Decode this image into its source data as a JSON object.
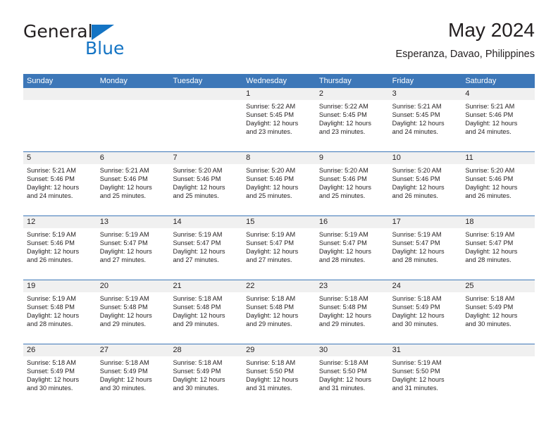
{
  "brand": {
    "name_top": "General",
    "name_bottom": "Blue",
    "triangle_color": "#1474c4"
  },
  "header": {
    "title": "May 2024",
    "subtitle": "Esperanza, Davao, Philippines",
    "accent_color": "#3d77b8",
    "band_color": "#f0f0f0"
  },
  "calendar": {
    "weekday_headers": [
      "Sunday",
      "Monday",
      "Tuesday",
      "Wednesday",
      "Thursday",
      "Friday",
      "Saturday"
    ],
    "weeks": [
      [
        {
          "day": "",
          "lines": []
        },
        {
          "day": "",
          "lines": []
        },
        {
          "day": "",
          "lines": []
        },
        {
          "day": "1",
          "lines": [
            "Sunrise: 5:22 AM",
            "Sunset: 5:45 PM",
            "Daylight: 12 hours",
            "and 23 minutes."
          ]
        },
        {
          "day": "2",
          "lines": [
            "Sunrise: 5:22 AM",
            "Sunset: 5:45 PM",
            "Daylight: 12 hours",
            "and 23 minutes."
          ]
        },
        {
          "day": "3",
          "lines": [
            "Sunrise: 5:21 AM",
            "Sunset: 5:45 PM",
            "Daylight: 12 hours",
            "and 24 minutes."
          ]
        },
        {
          "day": "4",
          "lines": [
            "Sunrise: 5:21 AM",
            "Sunset: 5:46 PM",
            "Daylight: 12 hours",
            "and 24 minutes."
          ]
        }
      ],
      [
        {
          "day": "5",
          "lines": [
            "Sunrise: 5:21 AM",
            "Sunset: 5:46 PM",
            "Daylight: 12 hours",
            "and 24 minutes."
          ]
        },
        {
          "day": "6",
          "lines": [
            "Sunrise: 5:21 AM",
            "Sunset: 5:46 PM",
            "Daylight: 12 hours",
            "and 25 minutes."
          ]
        },
        {
          "day": "7",
          "lines": [
            "Sunrise: 5:20 AM",
            "Sunset: 5:46 PM",
            "Daylight: 12 hours",
            "and 25 minutes."
          ]
        },
        {
          "day": "8",
          "lines": [
            "Sunrise: 5:20 AM",
            "Sunset: 5:46 PM",
            "Daylight: 12 hours",
            "and 25 minutes."
          ]
        },
        {
          "day": "9",
          "lines": [
            "Sunrise: 5:20 AM",
            "Sunset: 5:46 PM",
            "Daylight: 12 hours",
            "and 25 minutes."
          ]
        },
        {
          "day": "10",
          "lines": [
            "Sunrise: 5:20 AM",
            "Sunset: 5:46 PM",
            "Daylight: 12 hours",
            "and 26 minutes."
          ]
        },
        {
          "day": "11",
          "lines": [
            "Sunrise: 5:20 AM",
            "Sunset: 5:46 PM",
            "Daylight: 12 hours",
            "and 26 minutes."
          ]
        }
      ],
      [
        {
          "day": "12",
          "lines": [
            "Sunrise: 5:19 AM",
            "Sunset: 5:46 PM",
            "Daylight: 12 hours",
            "and 26 minutes."
          ]
        },
        {
          "day": "13",
          "lines": [
            "Sunrise: 5:19 AM",
            "Sunset: 5:47 PM",
            "Daylight: 12 hours",
            "and 27 minutes."
          ]
        },
        {
          "day": "14",
          "lines": [
            "Sunrise: 5:19 AM",
            "Sunset: 5:47 PM",
            "Daylight: 12 hours",
            "and 27 minutes."
          ]
        },
        {
          "day": "15",
          "lines": [
            "Sunrise: 5:19 AM",
            "Sunset: 5:47 PM",
            "Daylight: 12 hours",
            "and 27 minutes."
          ]
        },
        {
          "day": "16",
          "lines": [
            "Sunrise: 5:19 AM",
            "Sunset: 5:47 PM",
            "Daylight: 12 hours",
            "and 28 minutes."
          ]
        },
        {
          "day": "17",
          "lines": [
            "Sunrise: 5:19 AM",
            "Sunset: 5:47 PM",
            "Daylight: 12 hours",
            "and 28 minutes."
          ]
        },
        {
          "day": "18",
          "lines": [
            "Sunrise: 5:19 AM",
            "Sunset: 5:47 PM",
            "Daylight: 12 hours",
            "and 28 minutes."
          ]
        }
      ],
      [
        {
          "day": "19",
          "lines": [
            "Sunrise: 5:19 AM",
            "Sunset: 5:48 PM",
            "Daylight: 12 hours",
            "and 28 minutes."
          ]
        },
        {
          "day": "20",
          "lines": [
            "Sunrise: 5:19 AM",
            "Sunset: 5:48 PM",
            "Daylight: 12 hours",
            "and 29 minutes."
          ]
        },
        {
          "day": "21",
          "lines": [
            "Sunrise: 5:18 AM",
            "Sunset: 5:48 PM",
            "Daylight: 12 hours",
            "and 29 minutes."
          ]
        },
        {
          "day": "22",
          "lines": [
            "Sunrise: 5:18 AM",
            "Sunset: 5:48 PM",
            "Daylight: 12 hours",
            "and 29 minutes."
          ]
        },
        {
          "day": "23",
          "lines": [
            "Sunrise: 5:18 AM",
            "Sunset: 5:48 PM",
            "Daylight: 12 hours",
            "and 29 minutes."
          ]
        },
        {
          "day": "24",
          "lines": [
            "Sunrise: 5:18 AM",
            "Sunset: 5:49 PM",
            "Daylight: 12 hours",
            "and 30 minutes."
          ]
        },
        {
          "day": "25",
          "lines": [
            "Sunrise: 5:18 AM",
            "Sunset: 5:49 PM",
            "Daylight: 12 hours",
            "and 30 minutes."
          ]
        }
      ],
      [
        {
          "day": "26",
          "lines": [
            "Sunrise: 5:18 AM",
            "Sunset: 5:49 PM",
            "Daylight: 12 hours",
            "and 30 minutes."
          ]
        },
        {
          "day": "27",
          "lines": [
            "Sunrise: 5:18 AM",
            "Sunset: 5:49 PM",
            "Daylight: 12 hours",
            "and 30 minutes."
          ]
        },
        {
          "day": "28",
          "lines": [
            "Sunrise: 5:18 AM",
            "Sunset: 5:49 PM",
            "Daylight: 12 hours",
            "and 30 minutes."
          ]
        },
        {
          "day": "29",
          "lines": [
            "Sunrise: 5:18 AM",
            "Sunset: 5:50 PM",
            "Daylight: 12 hours",
            "and 31 minutes."
          ]
        },
        {
          "day": "30",
          "lines": [
            "Sunrise: 5:18 AM",
            "Sunset: 5:50 PM",
            "Daylight: 12 hours",
            "and 31 minutes."
          ]
        },
        {
          "day": "31",
          "lines": [
            "Sunrise: 5:19 AM",
            "Sunset: 5:50 PM",
            "Daylight: 12 hours",
            "and 31 minutes."
          ]
        },
        {
          "day": "",
          "lines": []
        }
      ]
    ]
  }
}
